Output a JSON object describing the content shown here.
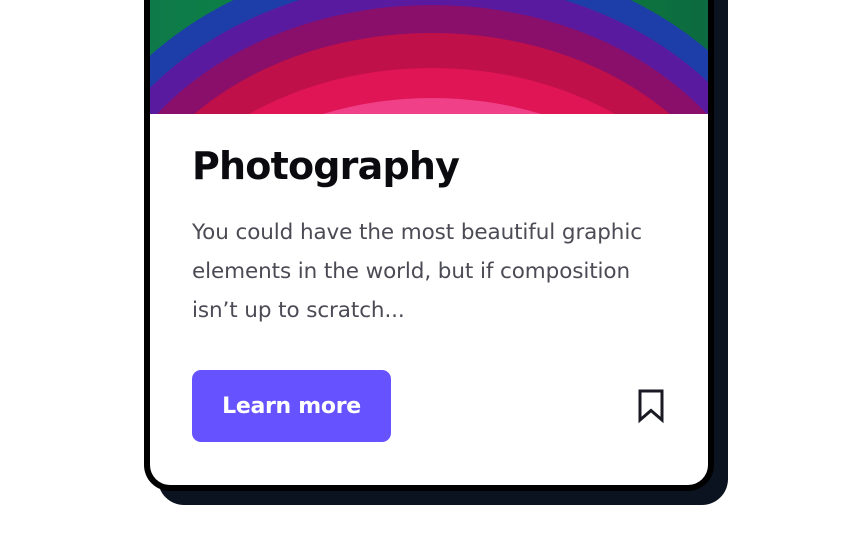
{
  "card": {
    "title": "Photography",
    "description": "You could have the most beautiful graphic elements in the world, but if composition isn’t up to scratch...",
    "cta_label": "Learn more",
    "bookmark_icon": "bookmark-icon"
  },
  "colors": {
    "accent": "#6652ff",
    "card_border": "#000000",
    "shadow": "#0b1220",
    "title": "#0a0a0f",
    "body_text": "#4b4b55"
  }
}
